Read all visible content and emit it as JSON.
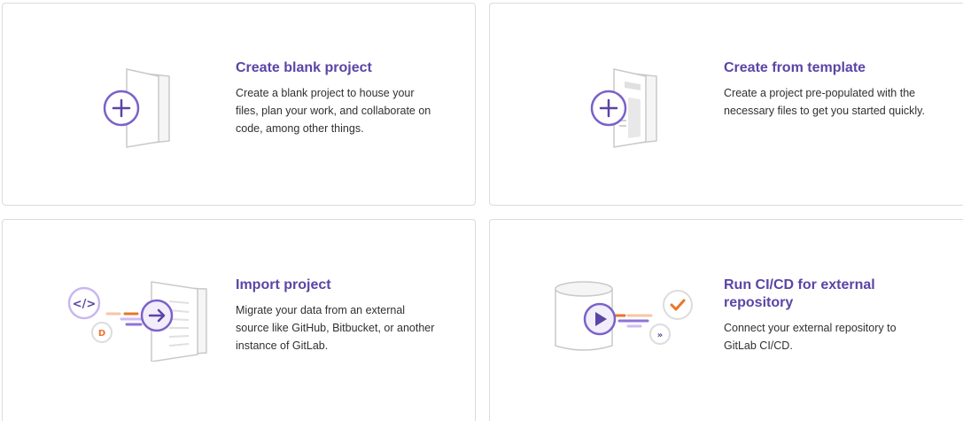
{
  "cards": [
    {
      "title": "Create blank project",
      "description": "Create a blank project to house your files, plan your work, and collaborate on code, among other things.",
      "icon": "blank-project-icon"
    },
    {
      "title": "Create from template",
      "description": "Create a project pre-populated with the necessary files to get you started quickly.",
      "icon": "template-project-icon"
    },
    {
      "title": "Import project",
      "description": "Migrate your data from an external source like GitHub, Bitbucket, or another instance of GitLab.",
      "icon": "import-project-icon"
    },
    {
      "title": "Run CI/CD for external repository",
      "description": "Connect your external repository to GitLab CI/CD.",
      "icon": "cicd-external-icon"
    }
  ],
  "colors": {
    "accent": "#5a45a6",
    "accent_light": "#f1edfa",
    "orange": "#e8762b",
    "border": "#dbdbdb",
    "text": "#303030"
  }
}
